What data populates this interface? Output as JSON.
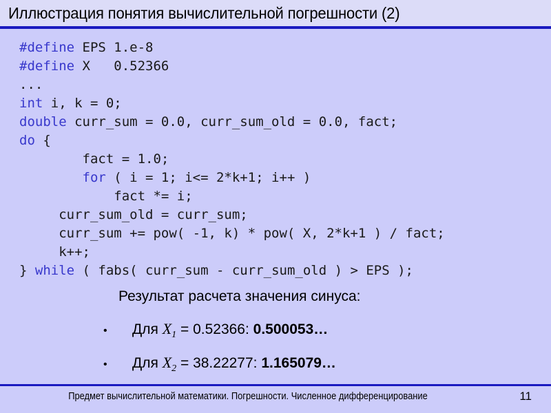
{
  "slide": {
    "title": "Иллюстрация понятия вычислительной погрешности (2)",
    "page_number": "11",
    "footer_text": "Предмет вычислительной математики. Погрешности. Численное дифференцирование",
    "colors": {
      "background": "#ccccfa",
      "header_background": "#dcdcf8",
      "rule": "#1a1ac0",
      "keyword": "#3838cc",
      "text": "#1a1a1a"
    }
  },
  "code": {
    "language": "c",
    "lines": [
      {
        "indent": 0,
        "segments": [
          {
            "text": "#define",
            "kind": "keyword"
          },
          {
            "text": " EPS 1.e-8",
            "kind": "plain"
          }
        ]
      },
      {
        "indent": 0,
        "segments": [
          {
            "text": "#define",
            "kind": "keyword"
          },
          {
            "text": " X   0.52366",
            "kind": "plain"
          }
        ]
      },
      {
        "indent": 0,
        "segments": [
          {
            "text": "...",
            "kind": "plain"
          }
        ]
      },
      {
        "indent": 0,
        "segments": [
          {
            "text": "int",
            "kind": "keyword"
          },
          {
            "text": " i, k = 0;",
            "kind": "plain"
          }
        ]
      },
      {
        "indent": 0,
        "segments": [
          {
            "text": "double",
            "kind": "keyword"
          },
          {
            "text": " curr_sum = 0.0, curr_sum_old = 0.0, fact;",
            "kind": "plain"
          }
        ]
      },
      {
        "indent": 0,
        "segments": [
          {
            "text": "do",
            "kind": "keyword"
          },
          {
            "text": " {",
            "kind": "plain"
          }
        ]
      },
      {
        "indent": 0,
        "segments": [
          {
            "text": "        fact = 1.0;",
            "kind": "plain"
          }
        ]
      },
      {
        "indent": 0,
        "segments": [
          {
            "text": "        ",
            "kind": "plain"
          },
          {
            "text": "for",
            "kind": "keyword"
          },
          {
            "text": " ( i = 1; i<= 2*k+1; i++ )",
            "kind": "plain"
          }
        ]
      },
      {
        "indent": 0,
        "segments": [
          {
            "text": "            fact *= i;",
            "kind": "plain"
          }
        ]
      },
      {
        "indent": 0,
        "segments": [
          {
            "text": "     curr_sum_old = curr_sum;",
            "kind": "plain"
          }
        ]
      },
      {
        "indent": 0,
        "segments": [
          {
            "text": "     curr_sum += pow( -1, k) * pow( X, 2*k+1 ) / fact;",
            "kind": "plain"
          }
        ]
      },
      {
        "indent": 0,
        "segments": [
          {
            "text": "     k++;",
            "kind": "plain"
          }
        ]
      },
      {
        "indent": 0,
        "segments": [
          {
            "text": "} ",
            "kind": "plain"
          },
          {
            "text": "while",
            "kind": "keyword"
          },
          {
            "text": " ( fabs( curr_sum - curr_sum_old ) > EPS );",
            "kind": "plain"
          }
        ]
      }
    ]
  },
  "results": {
    "heading": "Результат расчета значения синуса:",
    "bullet_glyph": "•",
    "items": [
      {
        "prefix": "Для ",
        "variable": "X",
        "subscript": "1",
        "equals": " = 0.52366: ",
        "value": "0.500053…"
      },
      {
        "prefix": "Для ",
        "variable": "X",
        "subscript": "2",
        "equals": " = 38.22277: ",
        "value": "1.165079…"
      }
    ]
  }
}
